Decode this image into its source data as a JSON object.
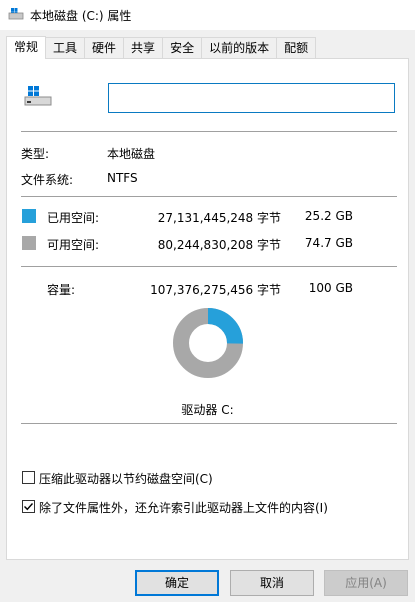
{
  "window": {
    "title": "本地磁盘 (C:) 属性"
  },
  "tabs": [
    {
      "label": "常规",
      "active": true
    },
    {
      "label": "工具",
      "active": false
    },
    {
      "label": "硬件",
      "active": false
    },
    {
      "label": "共享",
      "active": false
    },
    {
      "label": "安全",
      "active": false
    },
    {
      "label": "以前的版本",
      "active": false
    },
    {
      "label": "配额",
      "active": false
    }
  ],
  "general": {
    "volume_name_value": "",
    "type_label": "类型:",
    "type_value": "本地磁盘",
    "fs_label": "文件系统:",
    "fs_value": "NTFS",
    "used_label": "已用空间:",
    "used_bytes": "27,131,445,248 字节",
    "used_size": "25.2 GB",
    "free_label": "可用空间:",
    "free_bytes": "80,244,830,208 字节",
    "free_size": "74.7 GB",
    "capacity_label": "容量:",
    "capacity_bytes": "107,376,275,456 字节",
    "capacity_size": "100 GB",
    "drive_label": "驱动器 C:",
    "used_fraction": 0.2527,
    "compress_label": "压缩此驱动器以节约磁盘空间(C)",
    "compress_checked": false,
    "index_label": "除了文件属性外，还允许索引此驱动器上文件的内容(I)",
    "index_checked": true
  },
  "buttons": {
    "ok": "确定",
    "cancel": "取消",
    "apply": "应用(A)"
  },
  "colors": {
    "used": "#26a0da",
    "free": "#a8a8a8",
    "accent": "#0078d7"
  }
}
